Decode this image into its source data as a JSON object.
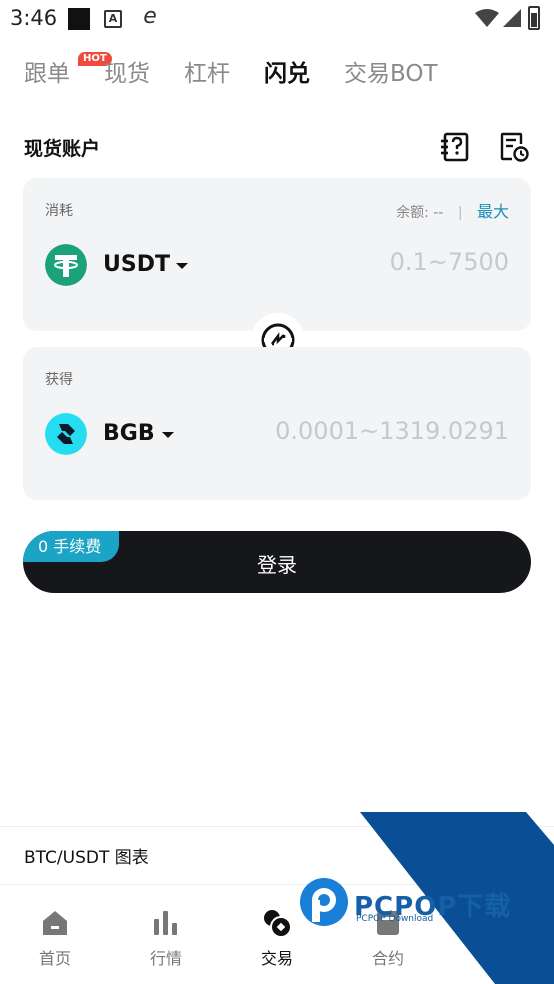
{
  "status_bar": {
    "time": "3:46"
  },
  "tabs": [
    {
      "label": "跟单",
      "badge": "HOT"
    },
    {
      "label": "现货"
    },
    {
      "label": "杠杆"
    },
    {
      "label": "闪兑",
      "active": true
    },
    {
      "label": "交易BOT"
    }
  ],
  "account": {
    "title": "现货账户"
  },
  "from_card": {
    "label": "消耗",
    "balance_label": "余额:",
    "balance_value": "--",
    "separator": "|",
    "max_label": "最大",
    "coin": "USDT",
    "amount_placeholder": "0.1~7500",
    "coin_color": "#1ba27a"
  },
  "to_card": {
    "label": "获得",
    "coin": "BGB",
    "amount_placeholder": "0.0001~1319.0291",
    "coin_color": "#26dcf0"
  },
  "login": {
    "fee_tag": "0 手续费",
    "label": "登录"
  },
  "chart_section": {
    "title": "BTC/USDT 图表"
  },
  "bottom_nav": [
    {
      "label": "首页",
      "icon": "home-icon"
    },
    {
      "label": "行情",
      "icon": "market-chart-icon"
    },
    {
      "label": "交易",
      "icon": "trade-icon",
      "active": true
    },
    {
      "label": "合约",
      "icon": "contract-icon"
    }
  ],
  "watermark": {
    "text": "PCPOP下载",
    "sub": "PCPOP Download"
  },
  "colors": {
    "accent": "#1ba4c6",
    "max_link": "#1a8fb8",
    "dark_button": "#16171a",
    "hot_badge": "#f04a3e",
    "card_bg": "#f3f4f6"
  }
}
